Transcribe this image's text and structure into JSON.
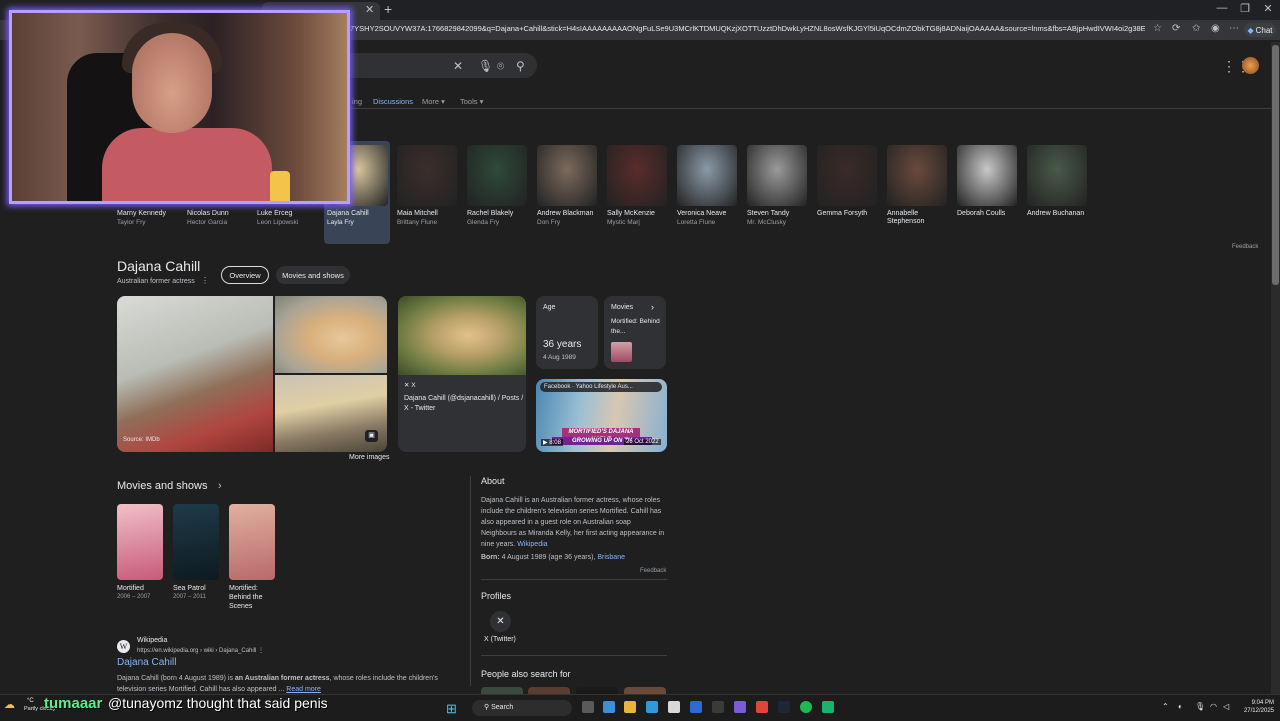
{
  "browser": {
    "url": "7YSHY2SOUVYW37A:1766829842099&q=Dajana+Cahill&stick=H4sIAAAAAAAAAONgFuLSe9U3MCrlKTDMUQKzjXOTTUzztDhDwkLyHZNL8osWsfKJGYl5iUqOCdmZObkTG8j8ADNaijOAAAAA&source=lnms&fbs=ABjpHwdIVWI4oi2g38E8_8busNm3pTf6tld...",
    "chat_label": "Chat"
  },
  "search": {
    "tabs": [
      "ing",
      "Discussions",
      "More",
      "Tools"
    ]
  },
  "carousel": [
    {
      "name": "Marny Kennedy",
      "role": "Taylor Fry",
      "color": "#6b5a4c"
    },
    {
      "name": "Nicolas Dunn",
      "role": "Hector Garcia",
      "color": "#5a4c42"
    },
    {
      "name": "Luke Erceg",
      "role": "Leon Lipowski",
      "color": "#4a4a4a"
    },
    {
      "name": "Dajana Cahill",
      "role": "Layla Fry",
      "color": "#d9c79f"
    },
    {
      "name": "Maia Mitchell",
      "role": "Brittany Flune",
      "color": "#3b2e2c"
    },
    {
      "name": "Rachel Blakely",
      "role": "Glenda Fry",
      "color": "#2e4a3a"
    },
    {
      "name": "Andrew Blackman",
      "role": "Don Fry",
      "color": "#7c6a5c"
    },
    {
      "name": "Sally McKenzie",
      "role": "Mystic Marj",
      "color": "#5a2c2a"
    },
    {
      "name": "Veronica Neave",
      "role": "Loretta Flune",
      "color": "#8a9aa8"
    },
    {
      "name": "Steven Tandy",
      "role": "Mr. McClusky",
      "color": "#9a9a9a"
    },
    {
      "name": "Gemma Forsyth",
      "role": "",
      "color": "#3a2a28"
    },
    {
      "name": "Annabelle Stephenson",
      "role": "",
      "color": "#6a4a3c"
    },
    {
      "name": "Deborah Coulls",
      "role": "",
      "color": "#c8c8c8"
    },
    {
      "name": "Andrew Buchanan",
      "role": "",
      "color": "#4a5a4a"
    }
  ],
  "feedback": "Feedback",
  "entity": {
    "title": "Dajana Cahill",
    "subtitle": "Australian former actress",
    "chip_overview": "Overview",
    "chip_movies": "Movies and shows",
    "image_source": "Source: IMDb",
    "more_images": "More images",
    "x_card_source": "X",
    "x_card_title": "Dajana Cahill (@dsjanacahill) / Posts / X - Twitter",
    "age_label": "Age",
    "age_value": "36 years",
    "age_date": "4 Aug 1989",
    "movies_label": "Movies",
    "movies_item": "Mortified: Behind the...",
    "video_source": "Facebook · Yahoo Lifestyle Aus...",
    "video_banner": "MORTIFIED'S DAJANA HAZLE",
    "video_banner2": "GROWING UP ON TH",
    "video_time": "▶ 8:08",
    "video_date": "26 Oct 2022"
  },
  "movies_shows": {
    "title": "Movies and shows",
    "items": [
      {
        "title": "Mortified",
        "years": "2006 – 2007",
        "color1": "#f0c0c8",
        "color2": "#c85a7a"
      },
      {
        "title": "Sea Patrol",
        "years": "2007 – 2011",
        "color1": "#1e3b4a",
        "color2": "#0e1a20"
      },
      {
        "title": "Mortified: Behind the Scenes",
        "years": "",
        "color1": "#e0b0a0",
        "color2": "#b86a6a"
      }
    ]
  },
  "wiki": {
    "name": "Wikipedia",
    "url": "https://en.wikipedia.org › wiki › Dajana_Cahill",
    "link": "Dajana Cahill",
    "snippet_pre": "Dajana Cahill (born 4 August 1989) is ",
    "snippet_bold": "an Australian former actress",
    "snippet_post": ", whose roles include the children's television series Mortified. Cahill has also appeared ... ",
    "read_more": "Read more"
  },
  "about": {
    "title": "About",
    "text": "Dajana Cahill is an Australian former actress, whose roles include the children's television series Mortified. Cahill has also appeared in a guest role on Australian soap Neighbours as Miranda Kelly, her first acting appearance in nine years. ",
    "wiki_link": "Wikipedia",
    "born_label": "Born:",
    "born_value": " 4 August 1989 (age 36 years), ",
    "born_place": "Brisbane",
    "feedback": "Feedback",
    "profiles_title": "Profiles",
    "x_label": "X (Twitter)",
    "pas_title": "People also search for"
  },
  "overlay": {
    "chat_user": "tumaaar",
    "chat_msg": "@tunayomz thought that said penis",
    "weather_temp": "°C",
    "weather": "Partly cloudy"
  },
  "taskbar": {
    "search": "Search",
    "time": "9:04 PM",
    "date": "27/12/2025"
  }
}
